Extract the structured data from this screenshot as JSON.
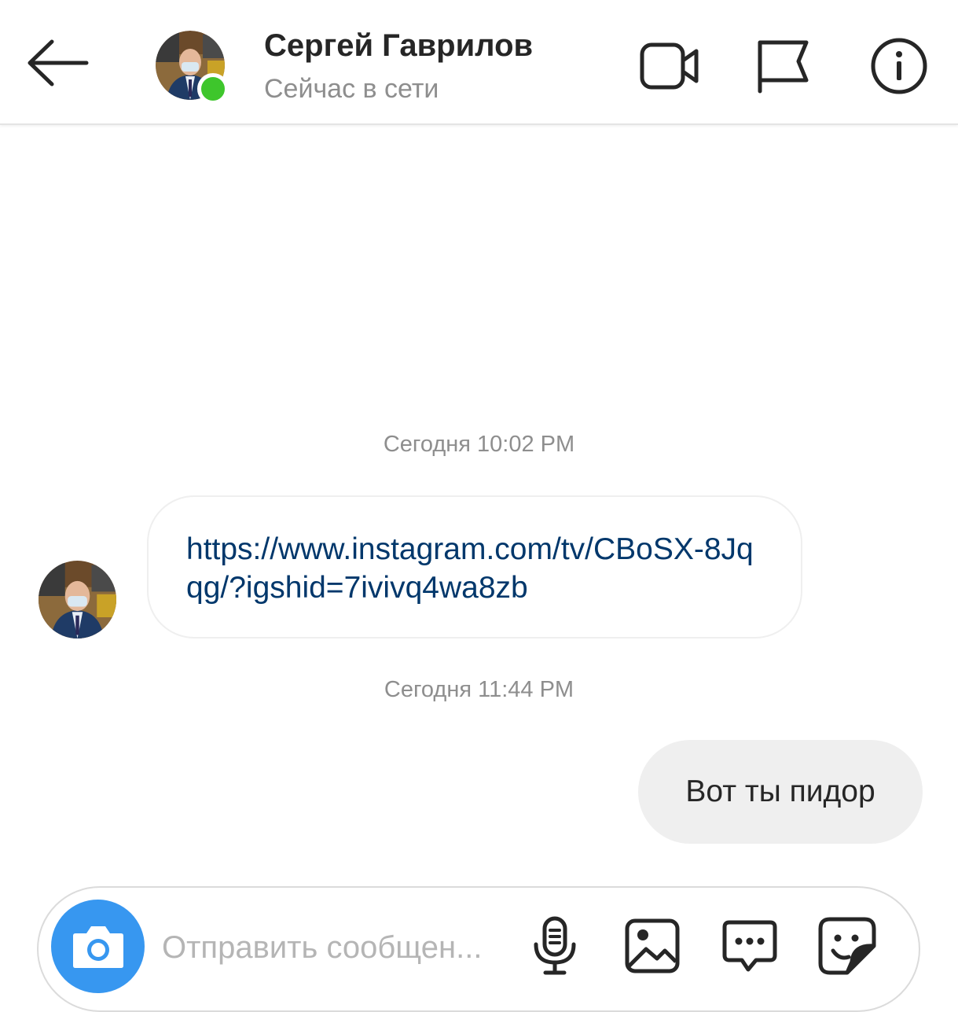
{
  "header": {
    "contact_name": "Сергей Гаврилов",
    "status": "Сейчас в сети",
    "icons": {
      "back": "arrow-left-icon",
      "video": "video-camera-icon",
      "report": "flag-icon",
      "info": "info-icon"
    },
    "online": true,
    "online_color": "#3ec62c"
  },
  "chat": {
    "messages": [
      {
        "timestamp": "Сегодня 10:02 PM",
        "direction": "incoming",
        "text": "https://www.instagram.com/tv/CBoSX-8Jqqg/?igshid=7ivivq4wa8zb"
      },
      {
        "timestamp": "Сегодня 11:44 PM",
        "direction": "outgoing",
        "text": "Вот ты пидор"
      }
    ],
    "link_color": "#00376b"
  },
  "composer": {
    "placeholder": "Отправить сообщен...",
    "value": "",
    "camera_color": "#3797f0",
    "icons": [
      "microphone-icon",
      "image-icon",
      "chat-bubble-icon",
      "sticker-icon"
    ]
  }
}
